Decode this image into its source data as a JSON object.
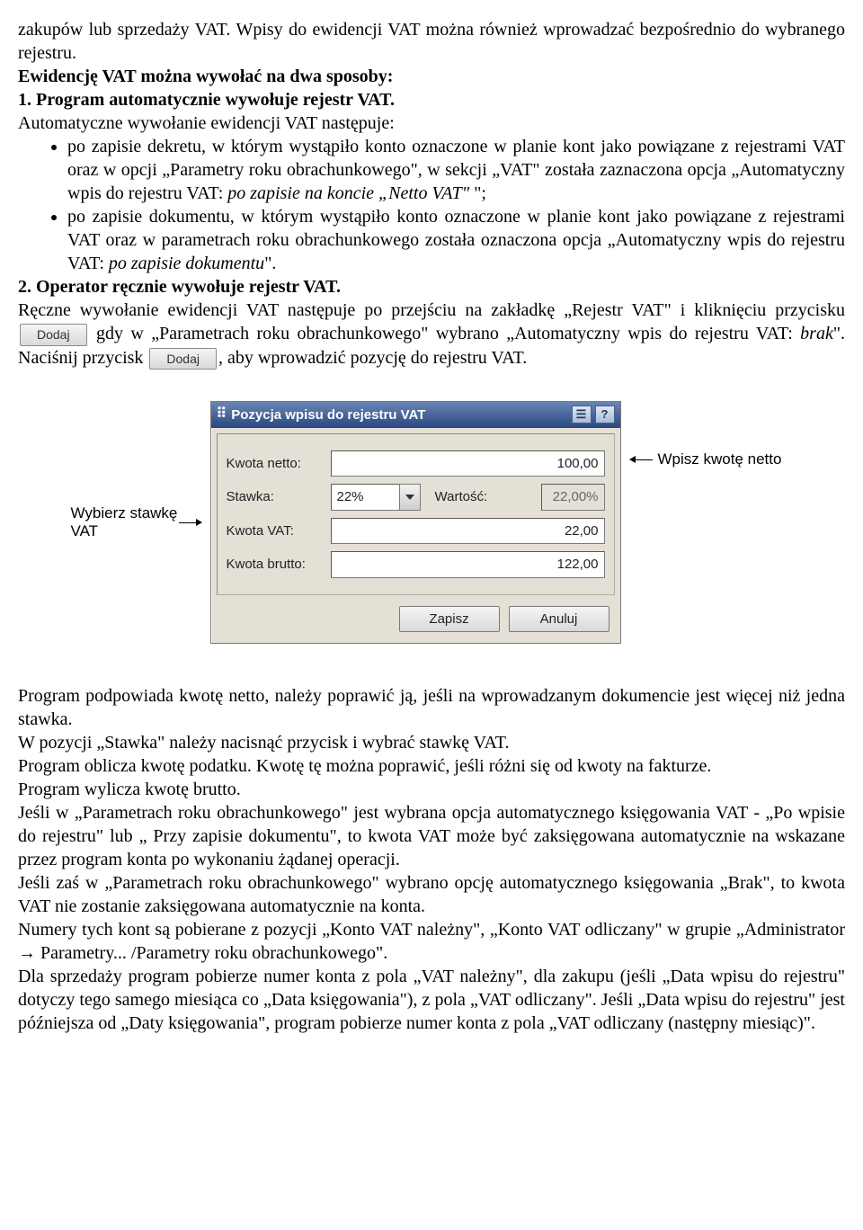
{
  "intro": {
    "p1": "zakupów lub sprzedaży VAT. Wpisy do ewidencji VAT można również wprowadzać bezpośrednio do wybranego rejestru.",
    "p2_bold": "Ewidencję VAT można wywołać na dwa sposoby:",
    "p3_bold": "1. Program automatycznie wywołuje rejestr VAT.",
    "p4": "Automatyczne wywołanie ewidencji VAT następuje:"
  },
  "bullets": {
    "b1a": "po zapisie dekretu, w którym wystąpiło konto oznaczone w planie kont jako powiązane z rejestrami VAT oraz w opcji „Parametry roku obrachunkowego\", w sekcji „VAT\" została zaznaczona opcja „Automatyczny wpis do rejestru VAT: ",
    "b1i": "po zapisie na koncie „Netto VAT\"",
    "b1c": " \";",
    "b2a": "po zapisie dokumentu, w którym wystąpiło konto oznaczone w planie kont jako powiązane z rejestrami VAT oraz w parametrach roku obrachunkowego została oznaczona opcja „Automatyczny wpis do rejestru VAT: ",
    "b2i": "po zapisie dokumentu",
    "b2c": "\"."
  },
  "sec2": {
    "h": "2. Operator ręcznie wywołuje rejestr VAT.",
    "p1": "Ręczne wywołanie ewidencji VAT następuje po przejściu na zakładkę „Rejestr VAT\" i kliknięciu przycisku ",
    "p1b": " gdy w „Parametrach roku obrachunkowego\" wybrano „Automatyczny wpis do rejestru VAT: ",
    "italic_brak": "brak",
    "p1c": "\". Naciśnij przycisk",
    "p1d": ", aby wprowadzić pozycję do rejestru VAT."
  },
  "btn": {
    "dodaj": "Dodaj"
  },
  "callouts": {
    "left": "Wybierz stawkę VAT",
    "right": "Wpisz kwotę netto"
  },
  "dialog": {
    "title": "Pozycja wpisu do rejestru VAT",
    "icon_menu": "☰",
    "icon_help": "?",
    "labels": {
      "netto": "Kwota netto:",
      "stawka": "Stawka:",
      "wartosc": "Wartość:",
      "vat": "Kwota VAT:",
      "brutto": "Kwota brutto:"
    },
    "values": {
      "netto": "100,00",
      "stawka": "22%",
      "wartosc": "22,00%",
      "vat": "22,00",
      "brutto": "122,00"
    },
    "buttons": {
      "save": "Zapisz",
      "cancel": "Anuluj"
    }
  },
  "after": {
    "p1": "Program podpowiada kwotę netto, należy poprawić ją, jeśli na wprowadzanym dokumencie jest więcej niż jedna stawka.",
    "p2": "W pozycji „Stawka\" należy nacisnąć przycisk i wybrać stawkę VAT.",
    "p3": "Program oblicza kwotę podatku. Kwotę tę można poprawić, jeśli różni się od kwoty na fakturze.",
    "p4": "Program wylicza kwotę brutto.",
    "p5": "Jeśli w „Parametrach roku obrachunkowego\" jest wybrana opcja automatycznego księgowania VAT - „Po wpisie do rejestru\" lub „ Przy zapisie dokumentu\", to kwota VAT może być zaksięgowana automatycznie na wskazane przez program konta po wykonaniu żądanej operacji.",
    "p6": "Jeśli zaś w „Parametrach roku obrachunkowego\" wybrano opcję automatycznego księgowania „Brak\", to kwota VAT nie zostanie zaksięgowana automatycznie na konta.",
    "p7": "Numery tych kont są pobierane z pozycji „Konto VAT należny\", „Konto VAT odliczany\" w grupie „Administrator → Parametry... /Parametry roku obrachunkowego\".",
    "p8": "Dla sprzedaży program pobierze numer konta z pola „VAT należny\", dla zakupu (jeśli „Data wpisu do rejestru\" dotyczy tego samego miesiąca co „Data księgowania\"), z pola „VAT odliczany\". Jeśli „Data wpisu do rejestru\" jest późniejsza od „Daty księgowania\", program pobierze numer konta z pola „VAT odliczany (następny miesiąc)\"."
  }
}
